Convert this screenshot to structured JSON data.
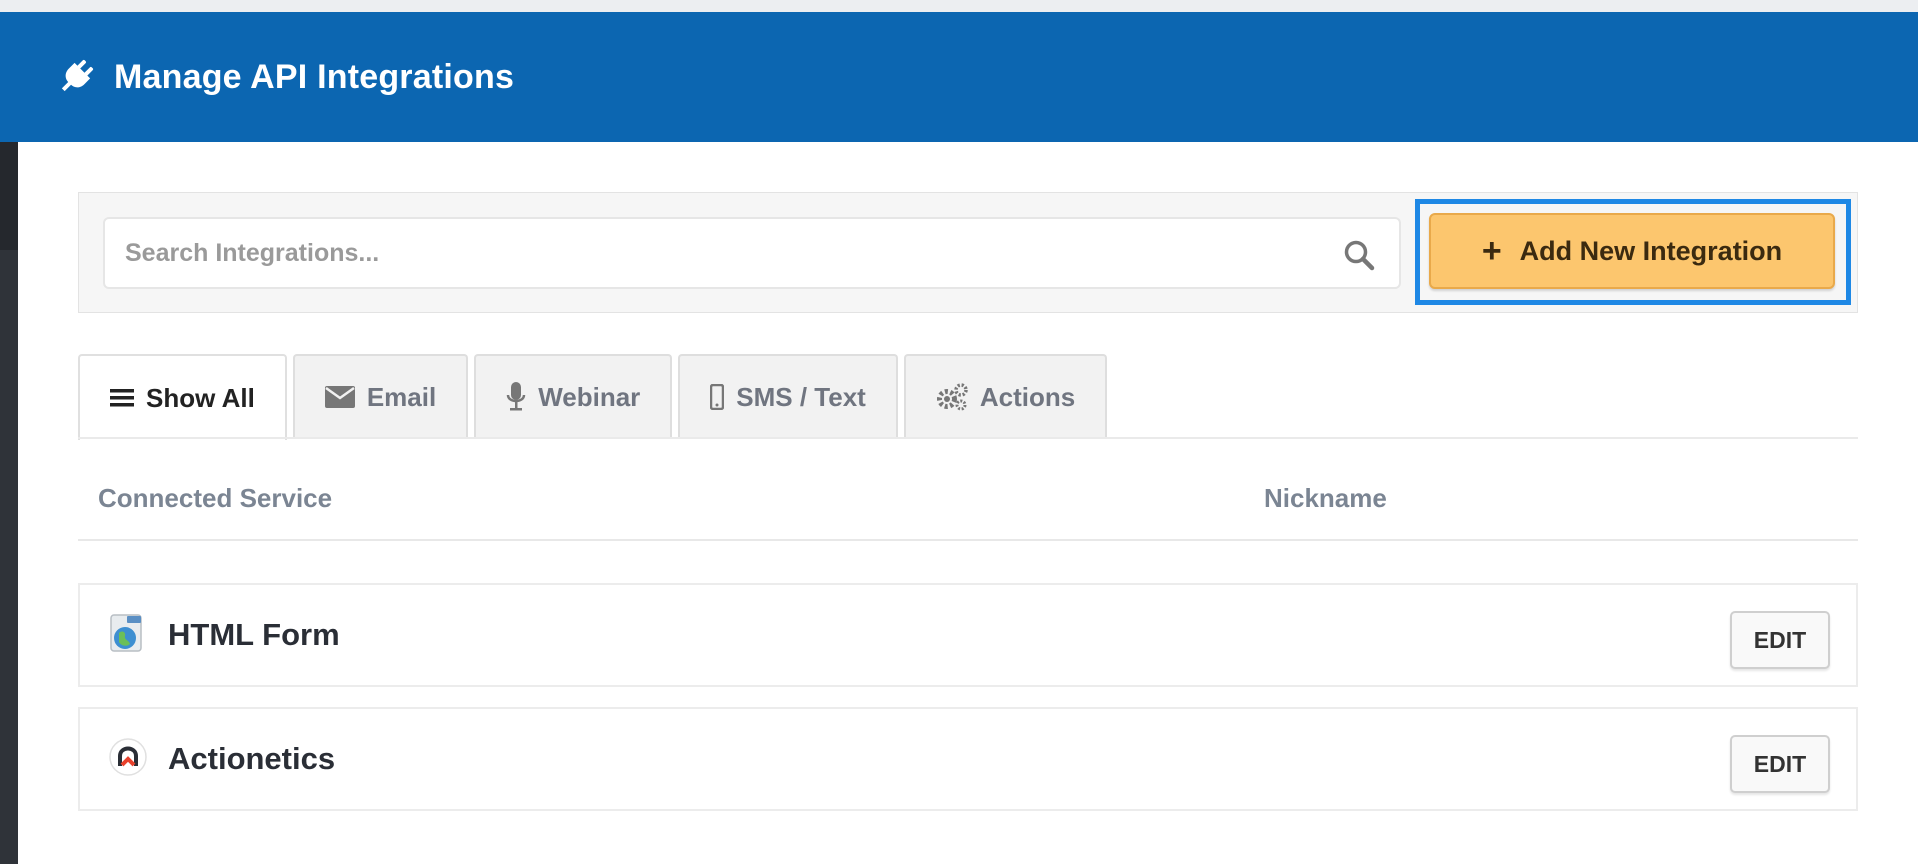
{
  "header": {
    "title": "Manage API Integrations",
    "icon": "plug-icon"
  },
  "search": {
    "placeholder": "Search Integrations...",
    "value": "",
    "icon": "search-icon"
  },
  "add_button": {
    "plus": "+",
    "label": "Add New Integration",
    "color": "#fcc66e",
    "highlight_color": "#1e88e5"
  },
  "tabs": [
    {
      "label": "Show All",
      "icon": "list-icon",
      "active": true
    },
    {
      "label": "Email",
      "icon": "envelope-icon",
      "active": false
    },
    {
      "label": "Webinar",
      "icon": "microphone-icon",
      "active": false
    },
    {
      "label": "SMS / Text",
      "icon": "mobile-phone-icon",
      "active": false
    },
    {
      "label": "Actions",
      "icon": "gears-icon",
      "active": false
    }
  ],
  "table": {
    "columns": [
      "Connected Service",
      "Nickname"
    ],
    "rows": [
      {
        "service": "HTML Form",
        "nickname": "",
        "icon": "html-form-icon",
        "action": "EDIT"
      },
      {
        "service": "Actionetics",
        "nickname": "",
        "icon": "actionetics-icon",
        "action": "EDIT"
      }
    ]
  },
  "colors": {
    "header_bg": "#0c66b1",
    "accent": "#1e88e5"
  }
}
